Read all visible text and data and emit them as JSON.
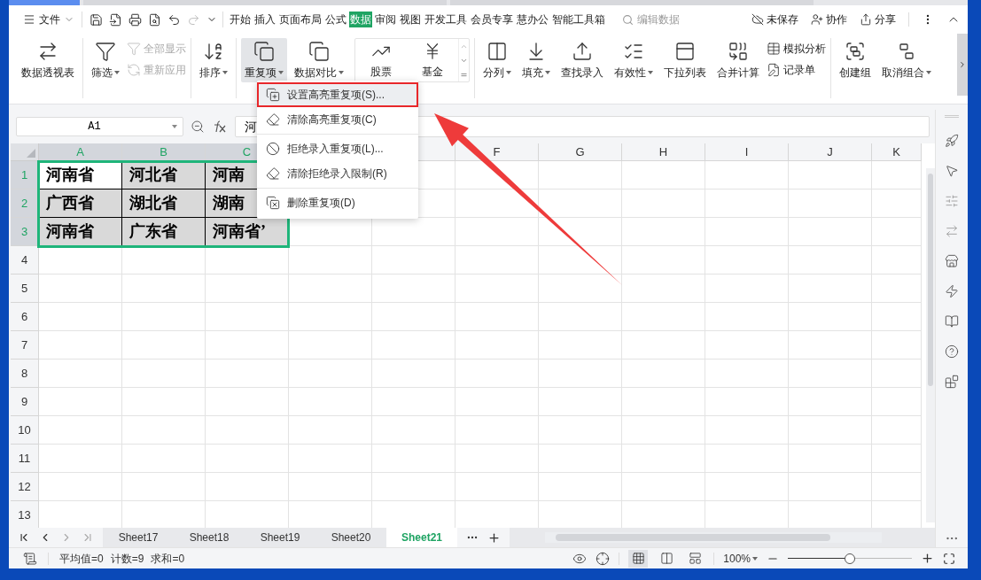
{
  "menu_bar": {
    "file_menu": "文件",
    "tabs": [
      {
        "label": "开始",
        "selected": false
      },
      {
        "label": "插入",
        "selected": false
      },
      {
        "label": "页面布局",
        "selected": false
      },
      {
        "label": "公式",
        "selected": false
      },
      {
        "label": "数据",
        "selected": true
      },
      {
        "label": "审阅",
        "selected": false
      },
      {
        "label": "视图",
        "selected": false
      },
      {
        "label": "开发工具",
        "selected": false
      },
      {
        "label": "会员专享",
        "selected": false
      },
      {
        "label": "慧办公",
        "selected": false
      },
      {
        "label": "智能工具箱",
        "selected": false
      }
    ],
    "search": {
      "placeholder": "编辑数据"
    },
    "actions": [
      "未保存",
      "协作",
      "分享"
    ]
  },
  "ribbon": {
    "groups": [
      {
        "items": [
          {
            "kind": "large",
            "label": "数据透视表",
            "dropdown": false,
            "pressed": false
          }
        ]
      },
      {
        "items": [
          {
            "kind": "large",
            "label": "筛选",
            "dropdown": true,
            "pressed": false
          },
          {
            "kind": "stack",
            "items": [
              {
                "label": "全部显示",
                "disabled": true
              },
              {
                "label": "重新应用",
                "disabled": true
              }
            ]
          }
        ]
      },
      {
        "items": [
          {
            "kind": "large",
            "label": "排序",
            "dropdown": true,
            "pressed": false
          }
        ]
      },
      {
        "items": [
          {
            "kind": "large",
            "label": "重复项",
            "dropdown": true,
            "pressed": true
          },
          {
            "kind": "large",
            "label": "数据对比",
            "dropdown": true,
            "pressed": false
          },
          {
            "kind": "gallery",
            "items": [
              {
                "label": "股票"
              },
              {
                "label": "基金"
              }
            ]
          }
        ]
      },
      {
        "items": [
          {
            "kind": "large",
            "label": "分列",
            "dropdown": true,
            "pressed": false
          },
          {
            "kind": "large",
            "label": "填充",
            "dropdown": true,
            "pressed": false
          },
          {
            "kind": "large",
            "label": "查找录入",
            "dropdown": false,
            "pressed": false
          },
          {
            "kind": "large",
            "label": "有效性",
            "dropdown": true,
            "pressed": false
          },
          {
            "kind": "large",
            "label": "下拉列表",
            "dropdown": false,
            "pressed": false
          },
          {
            "kind": "large",
            "label": "合并计算",
            "dropdown": false,
            "pressed": false
          },
          {
            "kind": "stack",
            "items": [
              {
                "label": "模拟分析",
                "disabled": false
              },
              {
                "label": "记录单",
                "disabled": false
              }
            ]
          }
        ]
      },
      {
        "items": [
          {
            "kind": "large",
            "label": "创建组",
            "dropdown": false,
            "pressed": false
          },
          {
            "kind": "large",
            "label": "取消组合",
            "dropdown": true,
            "pressed": false
          }
        ]
      }
    ]
  },
  "dropdown_menu": {
    "groups": [
      {
        "items": [
          {
            "label": "设置高亮重复项(S)...",
            "highlighted": true
          },
          {
            "label": "清除高亮重复项(C)",
            "highlighted": false
          }
        ]
      },
      {
        "items": [
          {
            "label": "拒绝录入重复项(L)...",
            "highlighted": false
          },
          {
            "label": "清除拒绝录入限制(R)",
            "highlighted": false
          }
        ]
      },
      {
        "items": [
          {
            "label": "删除重复项(D)",
            "highlighted": false
          }
        ]
      }
    ]
  },
  "formula_bar": {
    "name_box": "A1",
    "value": "河"
  },
  "sheet": {
    "columns": [
      {
        "label": "A",
        "selected": true
      },
      {
        "label": "B",
        "selected": true
      },
      {
        "label": "C",
        "selected": true
      }
    ],
    "columns_right": [
      {
        "label": "F",
        "selected": false
      },
      {
        "label": "G",
        "selected": false
      },
      {
        "label": "H",
        "selected": false
      },
      {
        "label": "I",
        "selected": false
      },
      {
        "label": "J",
        "selected": false
      },
      {
        "label": "K",
        "selected": false
      }
    ],
    "rows": [
      {
        "number": "1",
        "selected": true,
        "cells": [
          {
            "text": "河南省",
            "active": true
          },
          {
            "text": "河北省",
            "active": false
          },
          {
            "text": "河南",
            "active": false
          }
        ]
      },
      {
        "number": "2",
        "selected": true,
        "cells": [
          {
            "text": "广西省",
            "active": false
          },
          {
            "text": "湖北省",
            "active": false
          },
          {
            "text": "湖南",
            "active": false
          }
        ]
      },
      {
        "number": "3",
        "selected": true,
        "cells": [
          {
            "text": "河南省",
            "active": false
          },
          {
            "text": "广东省",
            "active": false
          },
          {
            "text": "河南省’",
            "active": false
          }
        ]
      },
      {
        "number": "4",
        "selected": false,
        "cells": []
      },
      {
        "number": "5",
        "selected": false,
        "cells": []
      },
      {
        "number": "6",
        "selected": false,
        "cells": []
      },
      {
        "number": "7",
        "selected": false,
        "cells": []
      },
      {
        "number": "8",
        "selected": false,
        "cells": []
      },
      {
        "number": "9",
        "selected": false,
        "cells": []
      },
      {
        "number": "10",
        "selected": false,
        "cells": []
      },
      {
        "number": "11",
        "selected": false,
        "cells": []
      },
      {
        "number": "12",
        "selected": false,
        "cells": []
      },
      {
        "number": "13",
        "selected": false,
        "cells": []
      }
    ]
  },
  "sheet_tabs": [
    {
      "label": "Sheet17",
      "selected": false
    },
    {
      "label": "Sheet18",
      "selected": false
    },
    {
      "label": "Sheet19",
      "selected": false
    },
    {
      "label": "Sheet20",
      "selected": false
    },
    {
      "label": "Sheet21",
      "selected": true
    }
  ],
  "status_bar": {
    "stats": [
      "平均值=0",
      "计数=9",
      "求和=0"
    ],
    "view_modes": [
      {
        "selected": true
      },
      {
        "selected": false
      },
      {
        "selected": false
      }
    ],
    "zoom": {
      "reading": "100%",
      "level": 0.5
    }
  }
}
